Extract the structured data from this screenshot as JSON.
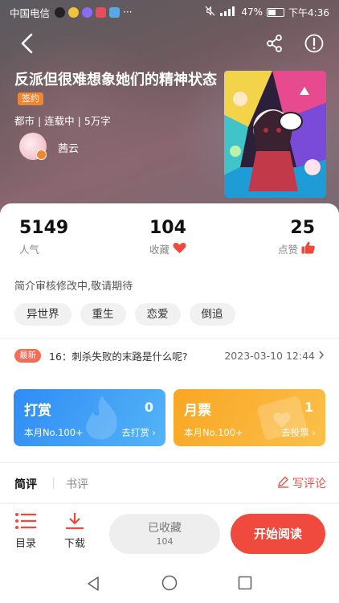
{
  "status_bar": {
    "carrier": "中国电信",
    "more": "···",
    "battery_percent": "47%",
    "time": "下午4:36"
  },
  "book": {
    "title": "反派但很难想象她们的精神状态",
    "signed_badge": "签约",
    "meta": "都市 | 连载中 | 5万字",
    "author": "茜云"
  },
  "stats": {
    "popularity": {
      "value": "5149",
      "label": "人气"
    },
    "favorites": {
      "value": "104",
      "label": "收藏"
    },
    "likes": {
      "value": "25",
      "label": "点赞"
    }
  },
  "description": "简介审核修改中,敬请期待",
  "tags": [
    "异世界",
    "重生",
    "恋爱",
    "倒追"
  ],
  "latest": {
    "badge": "最新",
    "chapter": "16：刺杀失败的末路是什么呢?",
    "datetime": "2023-03-10 12:44"
  },
  "rewards": {
    "tip": {
      "title": "打赏",
      "count": "0",
      "rank": "本月No.100+",
      "action": "去打赏"
    },
    "ticket": {
      "title": "月票",
      "count": "1",
      "rank": "本月No.100+",
      "action": "去投票"
    }
  },
  "reviews": {
    "tab_brief": "简评",
    "tab_book": "书评",
    "write": "写评论"
  },
  "bottom": {
    "catalog": "目录",
    "download": "下载",
    "collected": "已收藏",
    "collected_count": "104",
    "read": "开始阅读"
  },
  "colors": {
    "accent_red": "#f04a3e",
    "tip_blue": "#2f8cf5",
    "ticket_orange": "#f9a623",
    "signed_orange": "#f0862e"
  },
  "icons": [
    "back-icon",
    "share-icon",
    "info-icon",
    "heart-icon",
    "thumbs-up-icon",
    "chevron-right-icon",
    "pen-icon",
    "catalog-icon",
    "download-icon",
    "nav-back-icon",
    "nav-home-icon",
    "nav-recent-icon"
  ]
}
